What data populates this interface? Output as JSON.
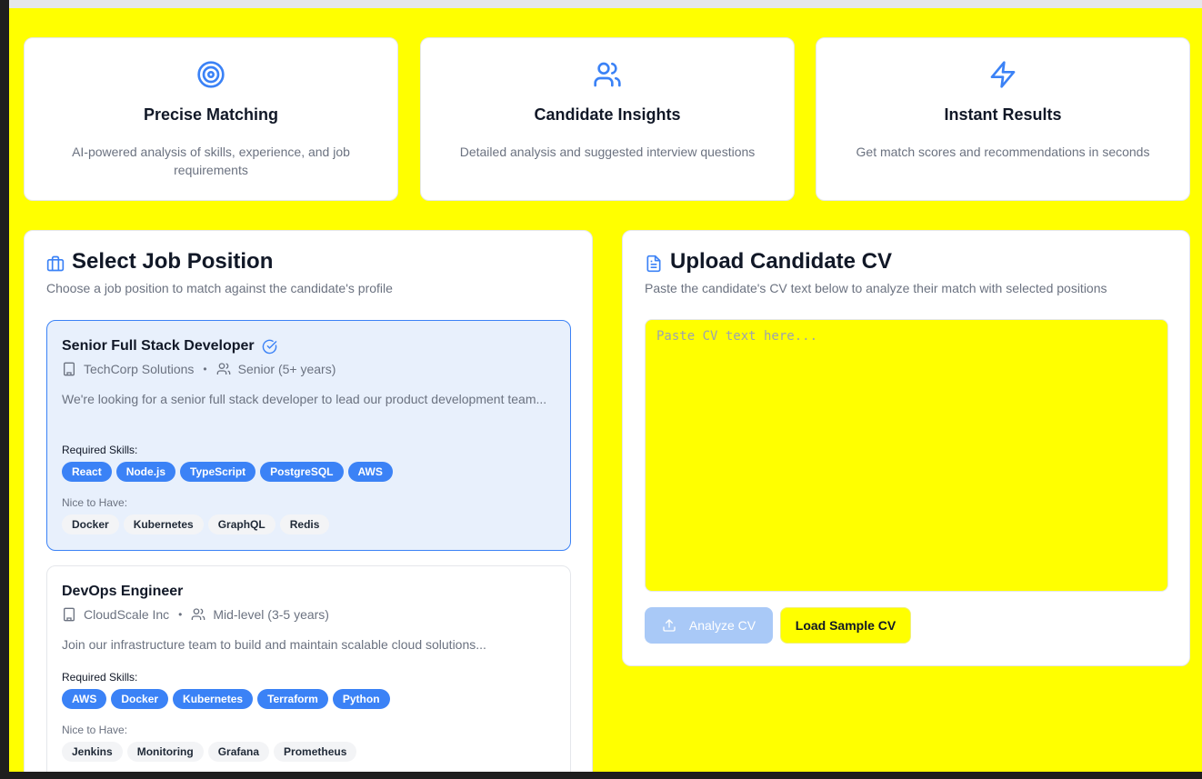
{
  "features": [
    {
      "icon": "target-icon",
      "title": "Precise Matching",
      "description": "AI-powered analysis of skills, experience, and job requirements"
    },
    {
      "icon": "users-icon",
      "title": "Candidate Insights",
      "description": "Detailed analysis and suggested interview questions"
    },
    {
      "icon": "lightning-icon",
      "title": "Instant Results",
      "description": "Get match scores and recommendations in seconds"
    }
  ],
  "job_panel": {
    "title": "Select Job Position",
    "subtitle": "Choose a job position to match against the candidate's profile",
    "required_label": "Required Skills:",
    "nice_label": "Nice to Have:",
    "jobs": [
      {
        "title": "Senior Full Stack Developer",
        "company": "TechCorp Solutions",
        "level": "Senior (5+ years)",
        "description": "We're looking for a senior full stack developer to lead our product development team...",
        "required": [
          "React",
          "Node.js",
          "TypeScript",
          "PostgreSQL",
          "AWS"
        ],
        "nice": [
          "Docker",
          "Kubernetes",
          "GraphQL",
          "Redis"
        ],
        "selected": true
      },
      {
        "title": "DevOps Engineer",
        "company": "CloudScale Inc",
        "level": "Mid-level (3-5 years)",
        "description": "Join our infrastructure team to build and maintain scalable cloud solutions...",
        "required": [
          "AWS",
          "Docker",
          "Kubernetes",
          "Terraform",
          "Python"
        ],
        "nice": [
          "Jenkins",
          "Monitoring",
          "Grafana",
          "Prometheus"
        ],
        "selected": false
      }
    ]
  },
  "cv_panel": {
    "title": "Upload Candidate CV",
    "subtitle": "Paste the candidate's CV text below to analyze their match with selected positions",
    "placeholder": "Paste CV text here...",
    "analyze_label": "Analyze CV",
    "sample_label": "Load Sample CV"
  },
  "colors": {
    "accent": "#3b82f6",
    "highlight": "#ffff00"
  }
}
